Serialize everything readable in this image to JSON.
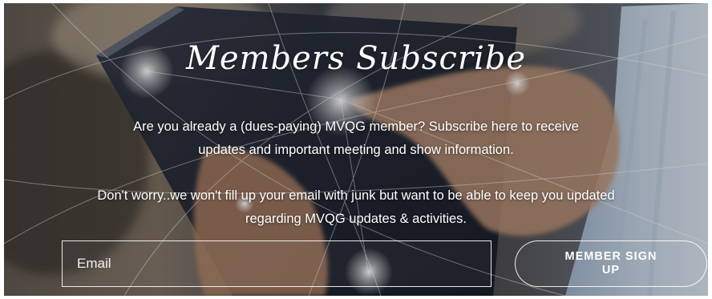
{
  "section": {
    "title": "Members Subscribe",
    "intro_line1": "Are you already a (dues-paying) MVQG member? Subscribe here to receive",
    "intro_line2": "updates and important meeting and show information.",
    "note_line1": "Don't worry..we won't fill up your email with junk but want to be able to keep you updated",
    "note_line2": "regarding MVQG updates & activities."
  },
  "form": {
    "email_placeholder": "Email",
    "signup_label": "MEMBER SIGN UP"
  }
}
